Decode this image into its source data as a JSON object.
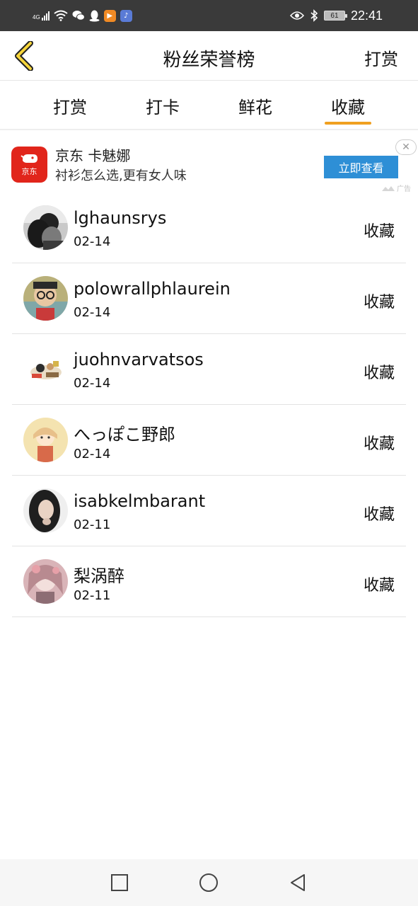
{
  "status_bar": {
    "network": "4G",
    "battery": "61",
    "time": "22:41"
  },
  "nav": {
    "title": "粉丝荣誉榜",
    "action": "打赏"
  },
  "tabs": [
    {
      "label": "打赏",
      "active": false
    },
    {
      "label": "打卡",
      "active": false
    },
    {
      "label": "鲜花",
      "active": false
    },
    {
      "label": "收藏",
      "active": true
    }
  ],
  "ad": {
    "brand_logo_text": "京东",
    "title": "京东 卡魅娜",
    "subtitle": "衬衫怎么选,更有女人味",
    "button": "立即查看",
    "close": "✕",
    "tag": "广告"
  },
  "fans": [
    {
      "name": "lghaunsrys",
      "date": "02-14",
      "action": "收藏"
    },
    {
      "name": "polowrallphlaurein",
      "date": "02-14",
      "action": "收藏"
    },
    {
      "name": "juohnvarvatsos",
      "date": "02-14",
      "action": "收藏"
    },
    {
      "name": "へっぽこ野郎",
      "date": "02-14",
      "action": "收藏"
    },
    {
      "name": "isabkelmbarant",
      "date": "02-11",
      "action": "收藏"
    },
    {
      "name": "梨涡醉",
      "date": "02-11",
      "action": "收藏"
    }
  ],
  "colors": {
    "accent": "#f0a020",
    "ad_button": "#2e8fd6",
    "jd_red": "#e1251b",
    "status_bar": "#3a3a3a"
  }
}
